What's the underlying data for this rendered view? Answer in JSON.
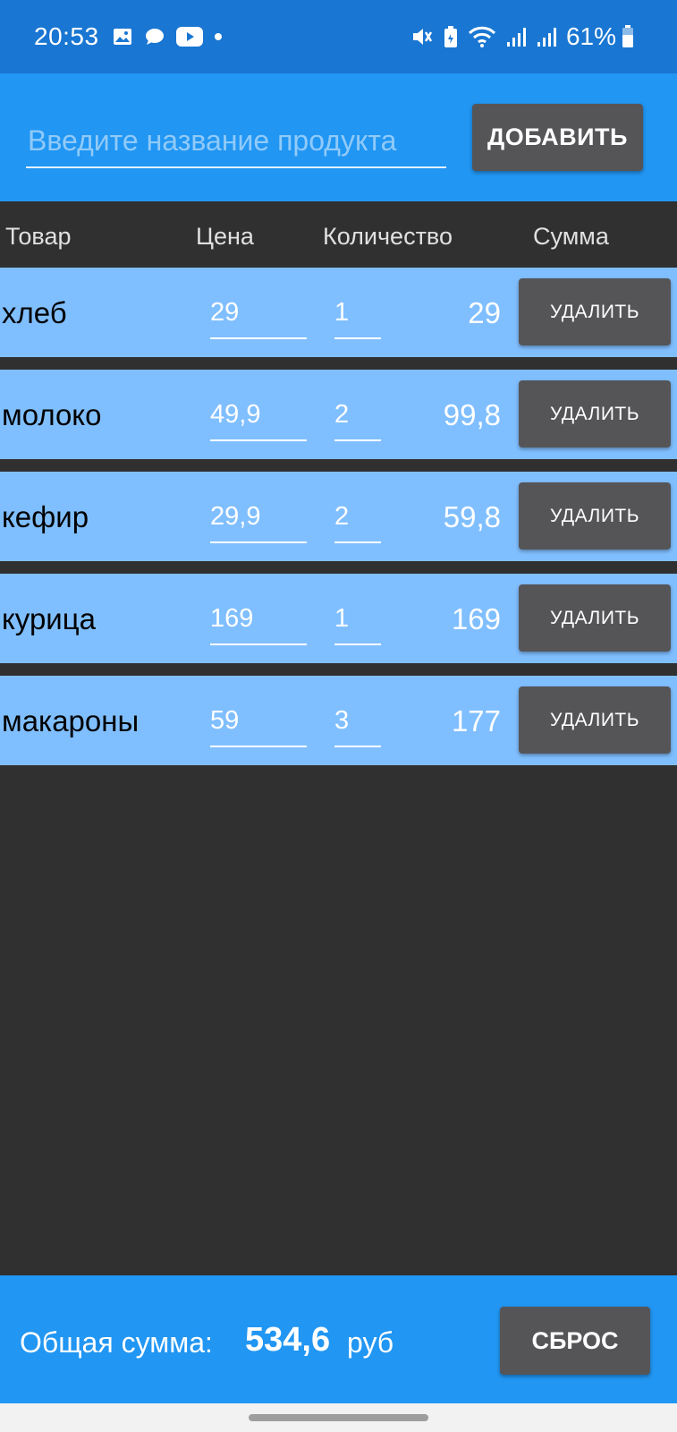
{
  "status_bar": {
    "time": "20:53",
    "battery": "61%",
    "icons_left": [
      "image-icon",
      "chat-icon",
      "youtube-icon",
      "dot-icon"
    ],
    "icons_right": [
      "mute-icon",
      "battery-saver-icon",
      "wifi-icon",
      "signal-icon",
      "signal-icon",
      "battery-icon"
    ]
  },
  "add_bar": {
    "input_placeholder": "Введите название продукта",
    "input_value": "",
    "add_label": "ДОБАВИТЬ"
  },
  "table": {
    "headers": {
      "name": "Товар",
      "price": "Цена",
      "qty": "Количество",
      "sum": "Сумма"
    },
    "delete_label": "УДАЛИТЬ",
    "rows": [
      {
        "name": "хлеб",
        "price": "29",
        "qty": "1",
        "sum": "29"
      },
      {
        "name": "молоко",
        "price": "49,9",
        "qty": "2",
        "sum": "99,8"
      },
      {
        "name": "кефир",
        "price": "29,9",
        "qty": "2",
        "sum": "59,8"
      },
      {
        "name": "курица",
        "price": "169",
        "qty": "1",
        "sum": "169"
      },
      {
        "name": "макароны",
        "price": "59",
        "qty": "3",
        "sum": "177"
      }
    ]
  },
  "footer": {
    "total_label": "Общая сумма:",
    "total_value": "534,6",
    "total_unit": "руб",
    "reset_label": "СБРОС"
  },
  "colors": {
    "status_bar": "#1976D2",
    "accent": "#2196F3",
    "row": "#80BFFF",
    "button": "#555558",
    "background": "#303030"
  }
}
